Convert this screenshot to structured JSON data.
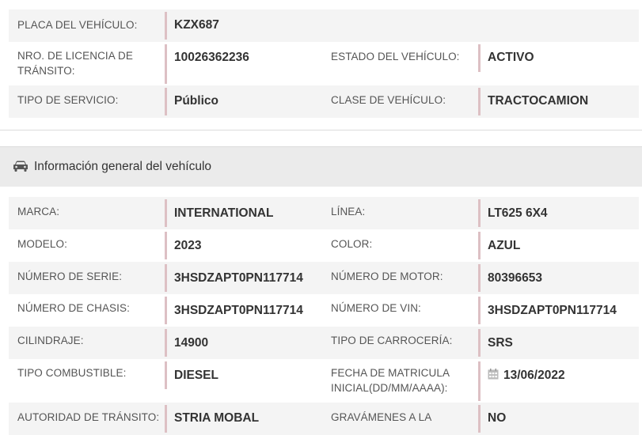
{
  "registro": {
    "placa_label": "PLACA DEL VEHÍCULO:",
    "placa_value": "KZX687",
    "licencia_label": "NRO. DE LICENCIA DE TRÁNSITO:",
    "licencia_value": "10026362236",
    "estado_label": "ESTADO DEL VEHÍCULO:",
    "estado_value": "ACTIVO",
    "servicio_label": "TIPO DE SERVICIO:",
    "servicio_value": "Público",
    "clase_label": "CLASE DE VEHÍCULO:",
    "clase_value": "TRACTOCAMION"
  },
  "section": {
    "icon": "car-icon",
    "title": "Información general del vehículo"
  },
  "general": {
    "marca_label": "MARCA:",
    "marca_value": "INTERNATIONAL",
    "linea_label": "LÍNEA:",
    "linea_value": "LT625 6X4",
    "modelo_label": "MODELO:",
    "modelo_value": "2023",
    "color_label": "COLOR:",
    "color_value": "AZUL",
    "serie_label": "NÚMERO DE SERIE:",
    "serie_value": "3HSDZAPT0PN117714",
    "motor_label": "NÚMERO DE MOTOR:",
    "motor_value": "80396653",
    "chasis_label": "NÚMERO DE CHASIS:",
    "chasis_value": "3HSDZAPT0PN117714",
    "vin_label": "NÚMERO DE VIN:",
    "vin_value": "3HSDZAPT0PN117714",
    "cilindraje_label": "CILINDRAJE:",
    "cilindraje_value": "14900",
    "carroceria_label": "TIPO DE CARROCERÍA:",
    "carroceria_value": "SRS",
    "combustible_label": "TIPO COMBUSTIBLE:",
    "combustible_value": "DIESEL",
    "fecha_label": "FECHA DE MATRICULA INICIAL(DD/MM/AAAA):",
    "fecha_value": "13/06/2022",
    "fecha_icon": "calendar-icon",
    "autoridad_label": "AUTORIDAD DE TRÁNSITO:",
    "autoridad_value": "STRIA MOBAL",
    "gravamenes_label": "GRAVÁMENES A LA",
    "gravamenes_value": "NO"
  },
  "colors": {
    "row_shade": "#f4f4f4",
    "value_bar": "#ddc0c4",
    "section_bg": "#ebebeb"
  }
}
